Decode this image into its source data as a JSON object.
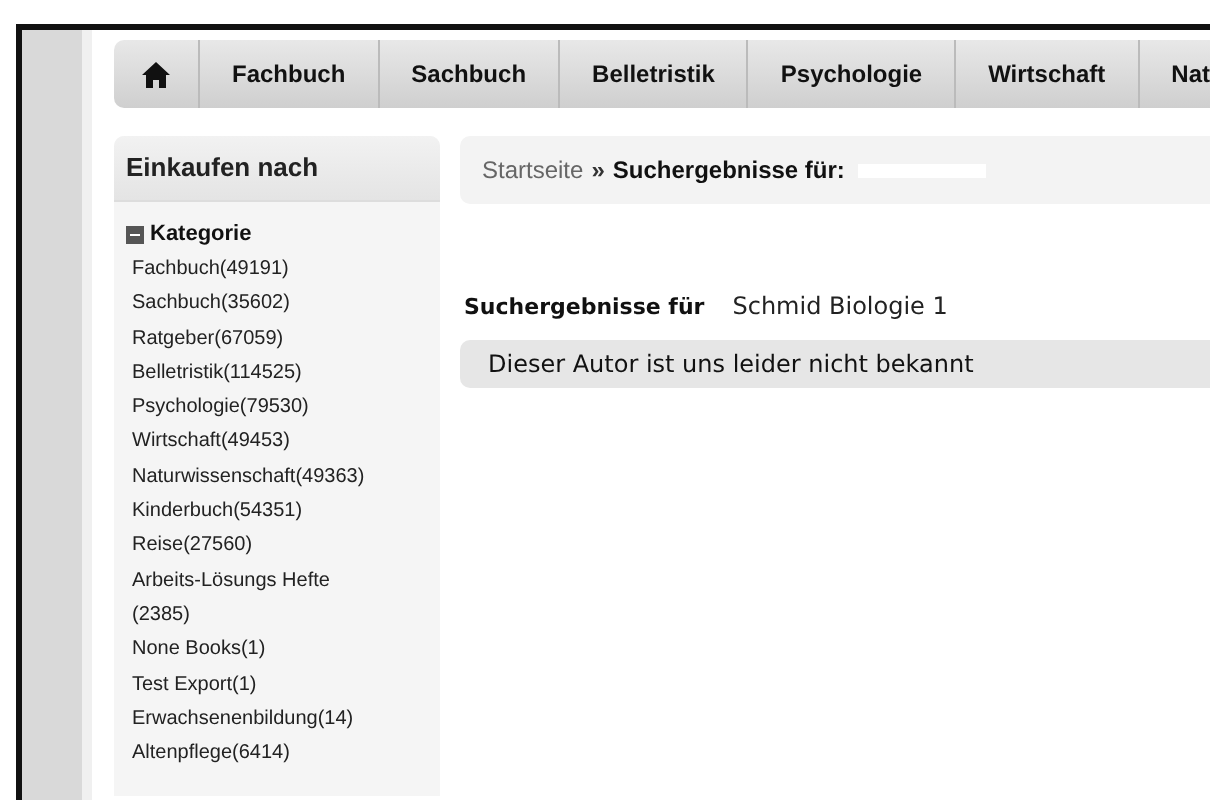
{
  "nav": {
    "home": {
      "selected": false
    },
    "items": [
      {
        "label": "Fachbuch"
      },
      {
        "label": "Sachbuch"
      },
      {
        "label": "Belletristik"
      },
      {
        "label": "Psychologie"
      },
      {
        "label": "Wirtschaft"
      },
      {
        "label": "Nat"
      }
    ]
  },
  "sidebar": {
    "title": "Einkaufen nach",
    "section": {
      "title": "Kategorie",
      "expanded": true,
      "items": [
        {
          "label": "Fachbuch(49191)"
        },
        {
          "label": "Sachbuch(35602)"
        },
        {
          "label": "Ratgeber(67059)"
        },
        {
          "label": "Belletristik(114525)"
        },
        {
          "label": "Psychologie(79530)"
        },
        {
          "label": "Wirtschaft(49453)"
        },
        {
          "label": "Naturwissenschaft(49363)"
        },
        {
          "label": "Kinderbuch(54351)"
        },
        {
          "label": "Reise(27560)"
        },
        {
          "label": "Arbeits-Lösungs Hefte (2385)"
        },
        {
          "label": "None Books(1)"
        },
        {
          "label": "Test Export(1)"
        },
        {
          "label": "Erwachsenenbildung(14)"
        },
        {
          "label": "Altenpflege(6414)"
        }
      ]
    }
  },
  "breadcrumb": {
    "home": "Startseite",
    "separator": "»",
    "current": "Suchergebnisse für:"
  },
  "results": {
    "label": "Suchergebnisse für",
    "query": "Schmid Biologie 1",
    "message": "Dieser Autor ist uns leider nicht bekannt"
  }
}
